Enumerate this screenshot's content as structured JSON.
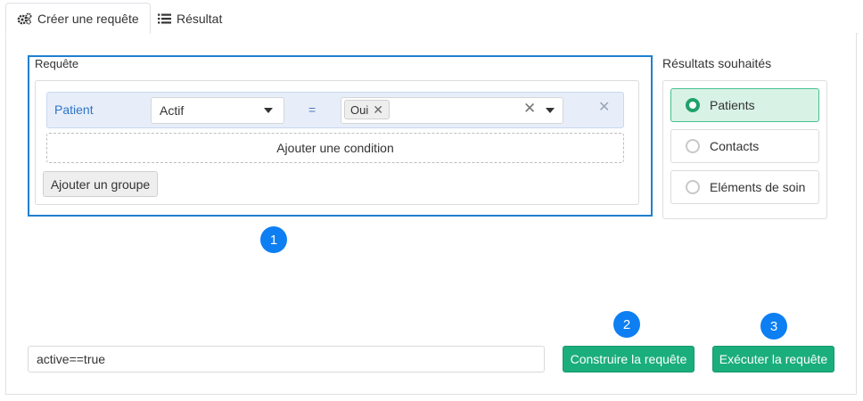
{
  "tabs": [
    {
      "label": "Créer une requête",
      "icon": "gears-icon",
      "active": true
    },
    {
      "label": "Résultat",
      "icon": "list-icon",
      "active": false
    }
  ],
  "query": {
    "title": "Requête",
    "condition": {
      "field": "Patient",
      "attribute": "Actif",
      "operator": "=",
      "value_chip": "Oui"
    },
    "add_condition_label": "Ajouter une condition",
    "add_group_label": "Ajouter un groupe"
  },
  "results": {
    "title": "Résultats souhaités",
    "options": [
      {
        "label": "Patients",
        "selected": true
      },
      {
        "label": "Contacts",
        "selected": false
      },
      {
        "label": "Eléments de soin",
        "selected": false
      }
    ]
  },
  "badges": [
    "1",
    "2",
    "3"
  ],
  "expression": {
    "value": "active==true"
  },
  "buttons": {
    "build": "Construire la requête",
    "execute": "Exécuter la requête"
  },
  "colors": {
    "accent_blue": "#1f7fd0",
    "badge_blue": "#0d7ff2",
    "button_green": "#1aae7c",
    "selected_bg": "#d9f2e6"
  }
}
